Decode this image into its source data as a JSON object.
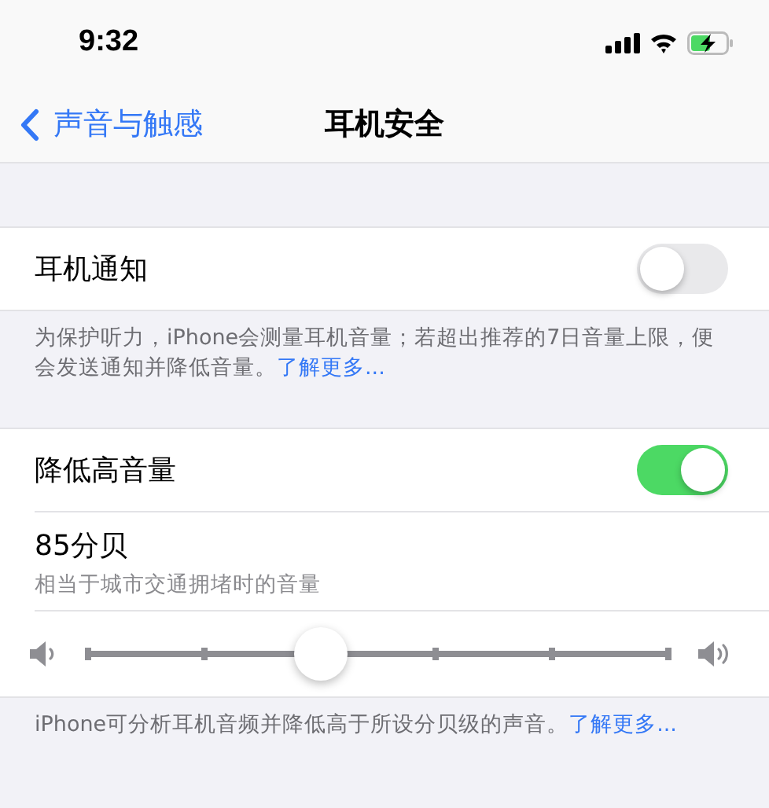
{
  "status_bar": {
    "time": "9:32"
  },
  "nav": {
    "back": "声音与触感",
    "title": "耳机安全"
  },
  "sections": [
    {
      "rows": [
        {
          "kind": "toggle",
          "label": "耳机通知",
          "on": false
        }
      ],
      "footer": {
        "text": "为保护听力，iPhone会测量耳机音量；若超出推荐的7日音量上限，便会发送通知并降低音量。",
        "link": "了解更多..."
      }
    },
    {
      "rows": [
        {
          "kind": "toggle",
          "label": "降低高音量",
          "on": true
        },
        {
          "kind": "value",
          "title": "85分贝",
          "subtitle": "相当于城市交通拥堵时的音量"
        },
        {
          "kind": "slider",
          "level": 0.4
        }
      ],
      "footer": {
        "text": "iPhone可分析耳机音频并降低高于所设分贝级的声音。",
        "link": "了解更多..."
      }
    }
  ]
}
